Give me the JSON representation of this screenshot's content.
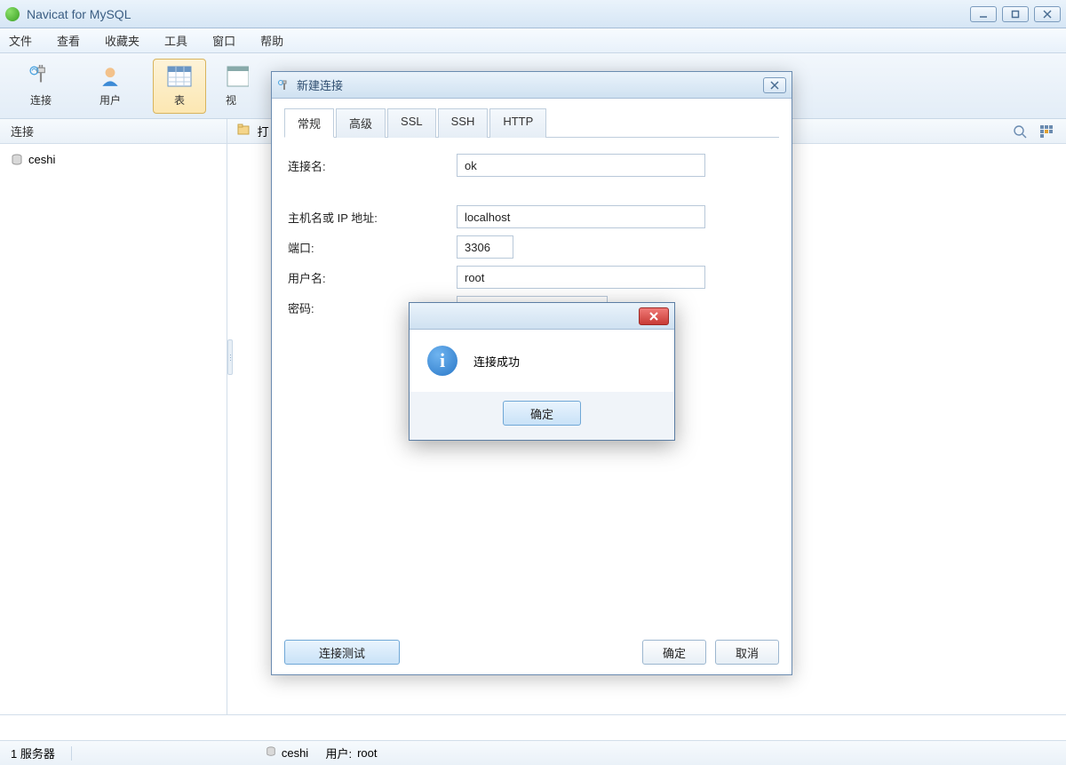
{
  "app": {
    "title": "Navicat for MySQL"
  },
  "menu": [
    "文件",
    "查看",
    "收藏夹",
    "工具",
    "窗口",
    "帮助"
  ],
  "toolbar": {
    "items": [
      {
        "id": "connect",
        "label": "连接"
      },
      {
        "id": "user",
        "label": "用户"
      },
      {
        "id": "table",
        "label": "表"
      },
      {
        "id": "view",
        "label": "视"
      }
    ]
  },
  "subbar": {
    "left_label": "连接",
    "open_label": "打"
  },
  "sidebar": {
    "items": [
      {
        "label": "ceshi"
      }
    ]
  },
  "dialog": {
    "title": "新建连接",
    "tabs": [
      "常规",
      "高级",
      "SSL",
      "SSH",
      "HTTP"
    ],
    "fields": {
      "conn_name_label": "连接名:",
      "conn_name_value": "ok",
      "host_label": "主机名或 IP 地址:",
      "host_value": "localhost",
      "port_label": "端口:",
      "port_value": "3306",
      "user_label": "用户名:",
      "user_value": "root",
      "pass_label": "密码:",
      "pass_value": ""
    },
    "buttons": {
      "test": "连接测试",
      "ok": "确定",
      "cancel": "取消"
    }
  },
  "msgbox": {
    "text": "连接成功",
    "ok": "确定"
  },
  "status": {
    "servers": "1 服务器",
    "conn": "ceshi",
    "user_label": "用户:",
    "user": "root"
  }
}
